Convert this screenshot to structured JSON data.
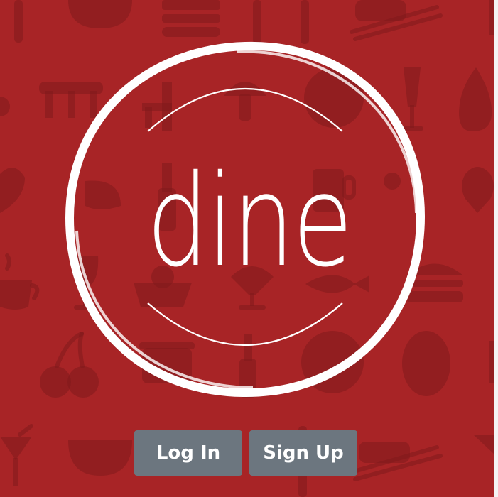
{
  "app": {
    "logo_text": "dine"
  },
  "actions": {
    "login_label": "Log In",
    "signup_label": "Sign Up"
  },
  "background": {
    "pattern": "food-icons",
    "icons": [
      "watermelon-icon",
      "burger-icon",
      "fork-icon",
      "sushi-icon",
      "chopsticks-icon",
      "table-icon",
      "chair-icon",
      "mushroom-icon",
      "plate-icon",
      "champagne-glass-icon",
      "pear-icon",
      "heart-icon",
      "wine-bottle-icon",
      "beer-mug-icon",
      "coffee-cup-icon",
      "wine-glass-icon",
      "cupcake-icon",
      "fish-icon",
      "cherries-icon",
      "cooking-pot-icon",
      "pizza-icon",
      "coffee-bean-icon",
      "cocktail-icon"
    ]
  },
  "colors": {
    "background": "#a82426",
    "pattern": "#7f1a1c",
    "logo": "#ffffff",
    "button": "#6c767f",
    "button_text": "#ffffff"
  }
}
